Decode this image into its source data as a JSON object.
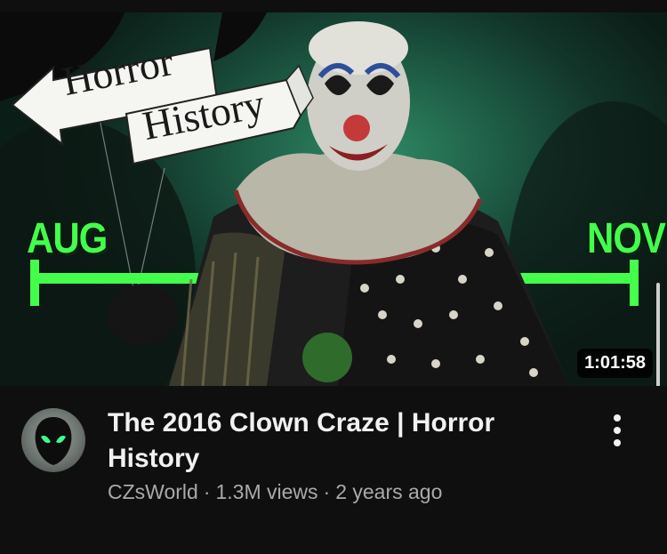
{
  "thumbnail": {
    "sign_line1": "Horror",
    "sign_line2": "History",
    "label_left": "AUG",
    "label_right": "NOV",
    "duration": "1:01:58",
    "accent_color": "#43ff4c"
  },
  "video": {
    "title": "The 2016 Clown Craze | Horror History",
    "channel": "CZsWorld",
    "views": "1.3M views",
    "age": "2 years ago",
    "separator": "·"
  },
  "icons": {
    "menu": "more-vertical-icon",
    "avatar": "alien-head-icon"
  }
}
